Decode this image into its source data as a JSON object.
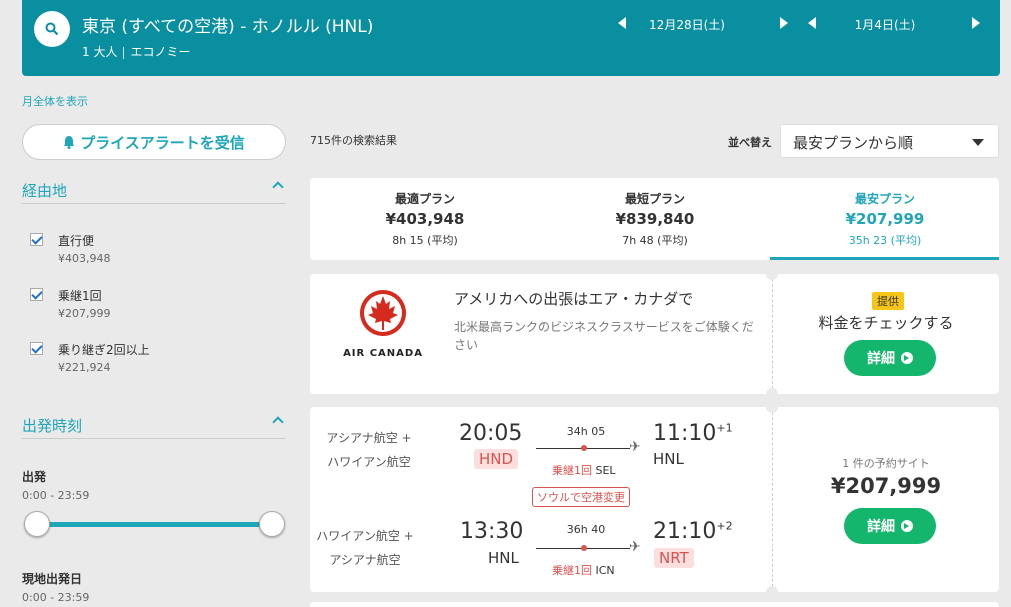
{
  "header": {
    "route": "東京 (すべての空港) - ホノルル (HNL)",
    "passengers": "1 大人",
    "cabin": "エコノミー",
    "depart_date": "12月28日(土)",
    "return_date": "1月4日(土)"
  },
  "sidebar": {
    "month_link": "月全体を表示",
    "price_alert": "プライスアラートを受信",
    "stops": {
      "title": "経由地",
      "items": [
        {
          "label": "直行便",
          "price": "¥403,948",
          "checked": true
        },
        {
          "label": "乗継1回",
          "price": "¥207,999",
          "checked": true
        },
        {
          "label": "乗り継ぎ2回以上",
          "price": "¥221,924",
          "checked": true
        }
      ]
    },
    "times": {
      "title": "出発時刻",
      "departure_label": "出発",
      "departure_range": "0:00 - 23:59",
      "local_label": "現地出発日",
      "local_range": "0:00 - 23:59"
    }
  },
  "results": {
    "count": "715件の検索結果",
    "sort_label": "並べ替え",
    "sort_value": "最安プランから順",
    "tabs": [
      {
        "name": "最適プラン",
        "price": "¥403,948",
        "duration": "8h 15 (平均)",
        "active": false
      },
      {
        "name": "最短プラン",
        "price": "¥839,840",
        "duration": "7h 48 (平均)",
        "active": false
      },
      {
        "name": "最安プラン",
        "price": "¥207,999",
        "duration": "35h 23 (平均)",
        "active": true
      }
    ]
  },
  "ad": {
    "brand": "AIR CANADA",
    "headline": "アメリカへの出張はエア・カナダで",
    "description": "北米最高ランクのビジネスクラスサービスをご体験ください",
    "badge": "提供",
    "cta_text": "料金をチェックする",
    "button": "詳細"
  },
  "flight": {
    "outbound": {
      "airlines": [
        "アシアナ航空 +",
        "ハワイアン航空"
      ],
      "dep_time": "20:05",
      "dep_airport": "HND",
      "duration": "34h 05",
      "stops": "乗継1回",
      "via": "SEL",
      "arr_time": "11:10",
      "arr_offset": "+1",
      "arr_airport": "HNL",
      "warning": "ソウルで空港変更"
    },
    "inbound": {
      "airlines": [
        "ハワイアン航空 +",
        "アシアナ航空"
      ],
      "dep_time": "13:30",
      "dep_airport": "HNL",
      "duration": "36h 40",
      "stops": "乗継1回",
      "via": "ICN",
      "arr_time": "21:10",
      "arr_offset": "+2",
      "arr_airport": "NRT"
    },
    "sites": "1 件の予約サイト",
    "price": "¥207,999",
    "button": "詳細"
  },
  "colors": {
    "accent": "#1fa6b9",
    "header": "#0a8fa0",
    "cta": "#14b56d",
    "alert": "#d9534f"
  }
}
